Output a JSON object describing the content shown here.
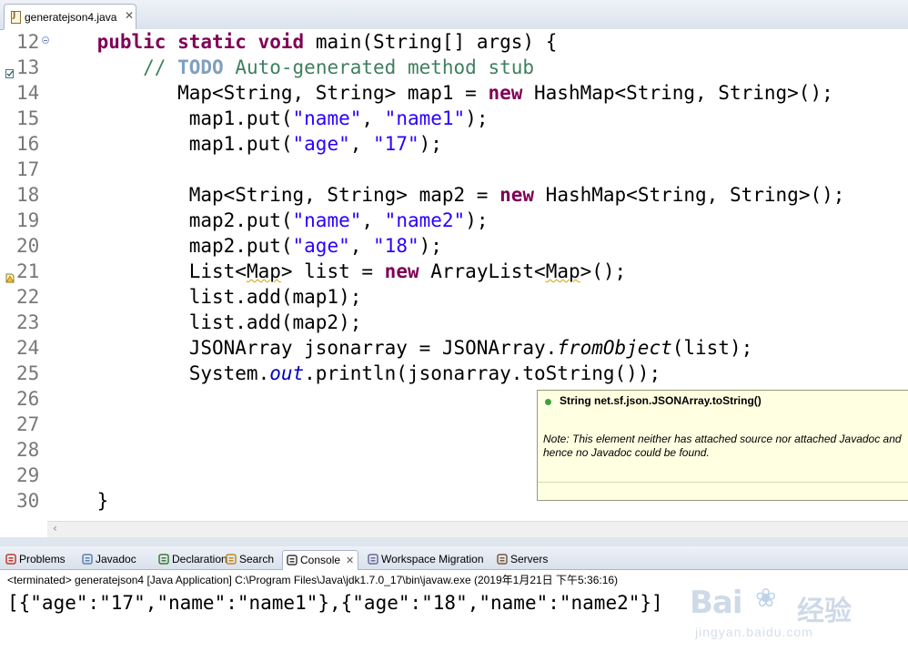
{
  "editor_tab": {
    "label": "generatejson4.java",
    "close": "✕"
  },
  "code_lines": [
    {
      "num": "12",
      "segments": [
        {
          "t": "    "
        },
        {
          "t": "public",
          "c": "kw"
        },
        {
          "t": " "
        },
        {
          "t": "static",
          "c": "kw"
        },
        {
          "t": " "
        },
        {
          "t": "void",
          "c": "kw"
        },
        {
          "t": " main(String[] args) {"
        }
      ]
    },
    {
      "num": "13",
      "segments": [
        {
          "t": "        "
        },
        {
          "t": "// ",
          "c": "cmt"
        },
        {
          "t": "TODO",
          "c": "todo"
        },
        {
          "t": " Auto-generated method stub",
          "c": "cmt"
        }
      ]
    },
    {
      "num": "14",
      "segments": [
        {
          "t": "           Map<String, String> map1 = "
        },
        {
          "t": "new",
          "c": "kw"
        },
        {
          "t": " HashMap<String, String>();"
        }
      ]
    },
    {
      "num": "15",
      "segments": [
        {
          "t": "            map1.put("
        },
        {
          "t": "\"name\"",
          "c": "str"
        },
        {
          "t": ", "
        },
        {
          "t": "\"name1\"",
          "c": "str"
        },
        {
          "t": ");"
        }
      ]
    },
    {
      "num": "16",
      "segments": [
        {
          "t": "            map1.put("
        },
        {
          "t": "\"age\"",
          "c": "str"
        },
        {
          "t": ", "
        },
        {
          "t": "\"17\"",
          "c": "str"
        },
        {
          "t": ");"
        }
      ]
    },
    {
      "num": "17",
      "segments": [
        {
          "t": ""
        }
      ]
    },
    {
      "num": "18",
      "segments": [
        {
          "t": "            Map<String, String> map2 = "
        },
        {
          "t": "new",
          "c": "kw"
        },
        {
          "t": " HashMap<String, String>();"
        }
      ]
    },
    {
      "num": "19",
      "segments": [
        {
          "t": "            map2.put("
        },
        {
          "t": "\"name\"",
          "c": "str"
        },
        {
          "t": ", "
        },
        {
          "t": "\"name2\"",
          "c": "str"
        },
        {
          "t": ");"
        }
      ]
    },
    {
      "num": "20",
      "segments": [
        {
          "t": "            map2.put("
        },
        {
          "t": "\"age\"",
          "c": "str"
        },
        {
          "t": ", "
        },
        {
          "t": "\"18\"",
          "c": "str"
        },
        {
          "t": ");"
        }
      ]
    },
    {
      "num": "21",
      "segments": [
        {
          "t": "            List<"
        },
        {
          "t": "Map",
          "c": "squig"
        },
        {
          "t": "> list = "
        },
        {
          "t": "new",
          "c": "kw"
        },
        {
          "t": " ArrayList<"
        },
        {
          "t": "Map",
          "c": "squig"
        },
        {
          "t": ">();"
        }
      ]
    },
    {
      "num": "22",
      "segments": [
        {
          "t": "            list.add(map1);"
        }
      ]
    },
    {
      "num": "23",
      "segments": [
        {
          "t": "            list.add(map2);"
        }
      ]
    },
    {
      "num": "24",
      "segments": [
        {
          "t": "            JSONArray jsonarray = JSONArray."
        },
        {
          "t": "fromObject",
          "c": "stat"
        },
        {
          "t": "(list);"
        }
      ]
    },
    {
      "num": "25",
      "segments": [
        {
          "t": "            System."
        },
        {
          "t": "out",
          "c": "fld"
        },
        {
          "t": ".println(jsonarray.toString());"
        }
      ]
    },
    {
      "num": "26",
      "segments": [
        {
          "t": ""
        }
      ]
    },
    {
      "num": "27",
      "segments": [
        {
          "t": ""
        }
      ]
    },
    {
      "num": "28",
      "segments": [
        {
          "t": ""
        }
      ]
    },
    {
      "num": "29",
      "segments": [
        {
          "t": ""
        }
      ]
    },
    {
      "num": "30",
      "segments": [
        {
          "t": "    }"
        }
      ]
    }
  ],
  "tooltip": {
    "header": "String net.sf.json.JSONArray.toString()",
    "note": "Note: This element neither has attached source nor attached Javadoc and hence no Javadoc could be found."
  },
  "bottom_tabs": [
    {
      "label": "Problems",
      "icon": "problems-icon",
      "active": false
    },
    {
      "label": "Javadoc",
      "icon": "javadoc-icon",
      "active": false
    },
    {
      "label": "Declaration",
      "icon": "declaration-icon",
      "active": false
    },
    {
      "label": "Search",
      "icon": "search-icon",
      "active": false
    },
    {
      "label": "Console",
      "icon": "console-icon",
      "active": true
    },
    {
      "label": "Workspace Migration",
      "icon": "workspace-migration-icon",
      "active": false
    },
    {
      "label": "Servers",
      "icon": "servers-icon",
      "active": false
    }
  ],
  "console": {
    "status": "<terminated> generatejson4 [Java Application] C:\\Program Files\\Java\\jdk1.7.0_17\\bin\\javaw.exe (2019年1月21日 下午5:36:16)",
    "output": "[{\"age\":\"17\",\"name\":\"name1\"},{\"age\":\"18\",\"name\":\"name2\"}]"
  },
  "watermark": {
    "brand_latin": "Bai",
    "brand_cn": "经验",
    "url": "jingyan.baidu.com"
  },
  "colors": {
    "keyword": "#7f0055",
    "string": "#2a00ff",
    "comment": "#3f7f5f",
    "tooltip_bg": "#ffffe1"
  }
}
